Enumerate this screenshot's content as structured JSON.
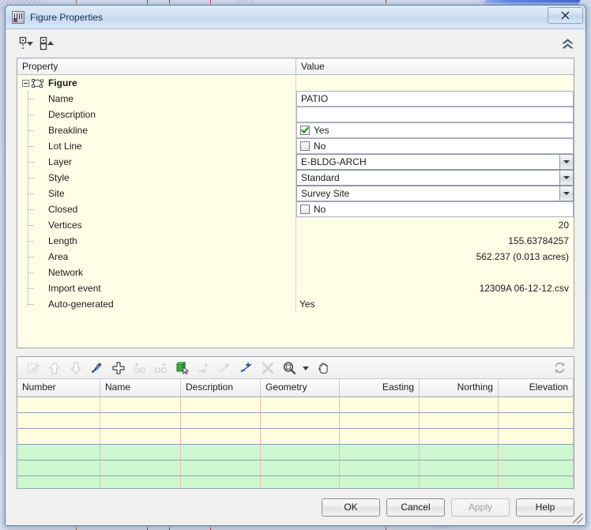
{
  "window": {
    "title": "Figure Properties",
    "app_icon": "figure-properties-icon",
    "close_label": "Close"
  },
  "prop_toolbar": {
    "collapse_all_icon": "tree-collapse-all-icon",
    "expand_all_icon": "tree-expand-all-icon",
    "collapse_panel_icon": "double-chevron-up-icon"
  },
  "property_grid": {
    "columns": [
      "Property",
      "Value"
    ],
    "rows": [
      {
        "name": "Figure",
        "kind": "root",
        "value": ""
      },
      {
        "name": "Name",
        "kind": "text",
        "value": "PATIO"
      },
      {
        "name": "Description",
        "kind": "text",
        "value": ""
      },
      {
        "name": "Breakline",
        "kind": "checkbox",
        "value": "Yes",
        "checked": true
      },
      {
        "name": "Lot Line",
        "kind": "checkbox",
        "value": "No",
        "checked": false
      },
      {
        "name": "Layer",
        "kind": "combo",
        "value": "E-BLDG-ARCH"
      },
      {
        "name": "Style",
        "kind": "combo",
        "value": "Standard"
      },
      {
        "name": "Site",
        "kind": "combo",
        "value": "Survey Site"
      },
      {
        "name": "Closed",
        "kind": "checkbox",
        "value": "No",
        "checked": false
      },
      {
        "name": "Vertices",
        "kind": "readonly-right",
        "value": "20"
      },
      {
        "name": "Length",
        "kind": "readonly-right",
        "value": "155.63784257"
      },
      {
        "name": "Area",
        "kind": "readonly-right",
        "value": "562.237 (0.013 acres)"
      },
      {
        "name": "Network",
        "kind": "readonly-right",
        "value": ""
      },
      {
        "name": "Import event",
        "kind": "readonly-right",
        "value": "12309A 06-12-12.csv"
      },
      {
        "name": "Auto-generated",
        "kind": "readonly-left",
        "value": "Yes"
      }
    ]
  },
  "point_panel": {
    "toolbar": [
      {
        "icon": "edit-point-icon",
        "enabled": false
      },
      {
        "icon": "move-up-icon",
        "enabled": false
      },
      {
        "icon": "move-down-icon",
        "enabled": false
      },
      {
        "icon": "add-curve-icon",
        "enabled": true
      },
      {
        "icon": "add-point-icon",
        "enabled": true
      },
      {
        "icon": "insert-point-before-icon",
        "enabled": false
      },
      {
        "icon": "insert-point-after-icon",
        "enabled": false
      },
      {
        "icon": "zoom-to-object-icon",
        "enabled": true
      },
      {
        "icon": "point-start-icon",
        "enabled": false
      },
      {
        "icon": "point-mid-icon",
        "enabled": false
      },
      {
        "icon": "point-end-icon",
        "enabled": true
      },
      {
        "icon": "delete-point-icon",
        "enabled": false
      },
      {
        "icon": "zoom-icon",
        "enabled": true
      },
      {
        "icon": "zoom-dropdown-icon",
        "enabled": true
      },
      {
        "icon": "pan-hand-icon",
        "enabled": true
      }
    ],
    "refresh_icon": "refresh-icon",
    "columns": [
      {
        "label": "Number",
        "align": "left"
      },
      {
        "label": "Name",
        "align": "left"
      },
      {
        "label": "Description",
        "align": "left"
      },
      {
        "label": "Geometry",
        "align": "left"
      },
      {
        "label": "Easting",
        "align": "right"
      },
      {
        "label": "Northing",
        "align": "right"
      },
      {
        "label": "Elevation",
        "align": "right"
      }
    ],
    "rows": [
      {
        "highlight": "yellow",
        "cells": [
          "",
          "",
          "",
          "",
          "",
          "",
          ""
        ]
      },
      {
        "highlight": "yellow",
        "cells": [
          "",
          "",
          "",
          "",
          "",
          "",
          ""
        ]
      },
      {
        "highlight": "yellow",
        "cells": [
          "",
          "",
          "",
          "",
          "",
          "",
          ""
        ]
      },
      {
        "highlight": "green",
        "cells": [
          "",
          "",
          "",
          "",
          "",
          "",
          ""
        ]
      },
      {
        "highlight": "green",
        "cells": [
          "",
          "",
          "",
          "",
          "",
          "",
          ""
        ]
      },
      {
        "highlight": "green",
        "cells": [
          "",
          "",
          "",
          "",
          "",
          "",
          ""
        ]
      }
    ]
  },
  "footer": {
    "ok": "OK",
    "cancel": "Cancel",
    "apply": "Apply",
    "help": "Help"
  },
  "colors": {
    "grid_background": "#ffffe8",
    "row_highlight_green": "#ccf7cf",
    "title_bar": "#d2e0f2",
    "checkmark_green": "#1e8a1e"
  }
}
